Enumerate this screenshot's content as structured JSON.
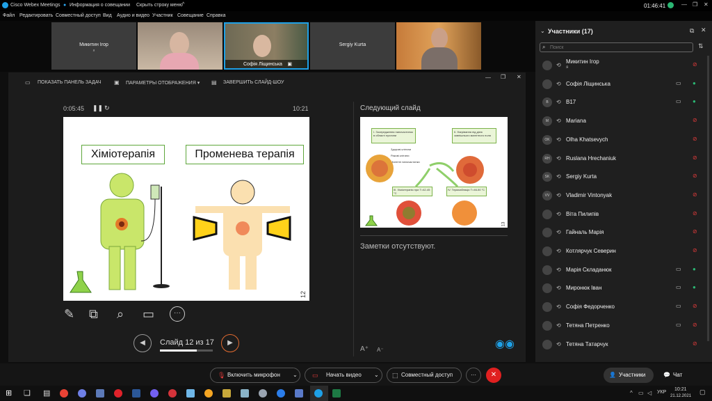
{
  "titlebar": {
    "app_title": "Cisco Webex Meetings",
    "meeting_info": "Информация о совещании",
    "hide_menu": "Скрыть строку меню",
    "clock": "01:46:41"
  },
  "menu": [
    "Файл",
    "Редактировать",
    "Совместный доступ",
    "Вид",
    "Аудио и видео",
    "Участник",
    "Совещание",
    "Справка"
  ],
  "thumbnails": [
    {
      "name": "Микитин Ігор",
      "sub": "я"
    },
    {
      "name": "",
      "sub": ""
    },
    {
      "name": "Софія Ліщинська",
      "sub": ""
    },
    {
      "name": "Sergiy Kurta",
      "sub": ""
    },
    {
      "name": "",
      "sub": ""
    }
  ],
  "stage_toolbar": {
    "taskbar_btn": "ПОКАЗАТЬ ПАНЕЛЬ ЗАДАЧ",
    "display_btn": "ПАРАМЕТРЫ ОТОБРАЖЕНИЯ ▾",
    "end_btn": "ЗАВЕРШИТЬ СЛАЙД-ШОУ"
  },
  "presenter": {
    "elapsed": "0:05:45",
    "clock": "10:21",
    "next_label": "Следующий слайд",
    "notes": "Заметки отсутствуют.",
    "slide_counter": "Слайд 12 из 17",
    "slide_progress": 0.7
  },
  "slide": {
    "left_title": "Хіміотерапія",
    "right_title": "Променева терапія",
    "page_no": "12"
  },
  "next_slide": {
    "t1": "I. Зосередження наночастинок в області пухлини",
    "t2": "II. Нагрівання під дією зовнішнього магнітного поля",
    "t3": "Здорові клітини",
    "t4": "Ракові клітини",
    "t5": "Магнітні наночастинки",
    "t6": "III. Хіміотерапія при T=42-45 °C",
    "t7": "IV. Термоабляція T=46-50 °C",
    "page_no": "13"
  },
  "participants": {
    "header": "Участники (17)",
    "search_placeholder": "Поиск",
    "list": [
      {
        "name": "Микитин Ігор",
        "sub": "я",
        "initials": "",
        "muted": true,
        "video": false
      },
      {
        "name": "Софія Ліщинська",
        "sub": "",
        "initials": "",
        "muted": false,
        "video": true
      },
      {
        "name": "В17",
        "sub": "",
        "initials": "В",
        "muted": false,
        "video": true
      },
      {
        "name": "Mariana",
        "sub": "",
        "initials": "M",
        "muted": true,
        "video": false
      },
      {
        "name": "Olha Khatsevych",
        "sub": "",
        "initials": "OK",
        "muted": true,
        "video": false
      },
      {
        "name": "Ruslana Hrechaniuk",
        "sub": "",
        "initials": "RH",
        "muted": true,
        "video": false
      },
      {
        "name": "Sergiy Kurta",
        "sub": "",
        "initials": "SK",
        "muted": true,
        "video": false
      },
      {
        "name": "Vladimir Vintonyak",
        "sub": "",
        "initials": "VV",
        "muted": true,
        "video": false
      },
      {
        "name": "Віта Пилипів",
        "sub": "",
        "initials": "",
        "muted": true,
        "video": false
      },
      {
        "name": "Гайналь Марія",
        "sub": "",
        "initials": "",
        "muted": true,
        "video": false
      },
      {
        "name": "Котлярчук Северин",
        "sub": "",
        "initials": "",
        "muted": true,
        "video": false
      },
      {
        "name": "Марія Складанюк",
        "sub": "",
        "initials": "",
        "muted": false,
        "video": true
      },
      {
        "name": "Миронюк Іван",
        "sub": "",
        "initials": "",
        "muted": false,
        "video": true
      },
      {
        "name": "Софія Федорченко",
        "sub": "",
        "initials": "",
        "muted": true,
        "video": true
      },
      {
        "name": "Тетяна Петренко",
        "sub": "",
        "initials": "",
        "muted": true,
        "video": true
      },
      {
        "name": "Тетяна Татарчук",
        "sub": "",
        "initials": "",
        "muted": true,
        "video": false
      }
    ]
  },
  "controls": {
    "mic": "Включить микрофон",
    "video": "Начать видео",
    "share": "Совместный доступ",
    "more": "···",
    "participants": "Участники",
    "chat": "Чат"
  },
  "win_taskbar": {
    "lang": "УКР",
    "time": "10:21",
    "date": "21.12.2021"
  },
  "colors": {
    "accent": "#1ea0e6",
    "mute_red": "#e23b3b",
    "end_red": "#e02020",
    "slide_green": "#5da63a"
  }
}
